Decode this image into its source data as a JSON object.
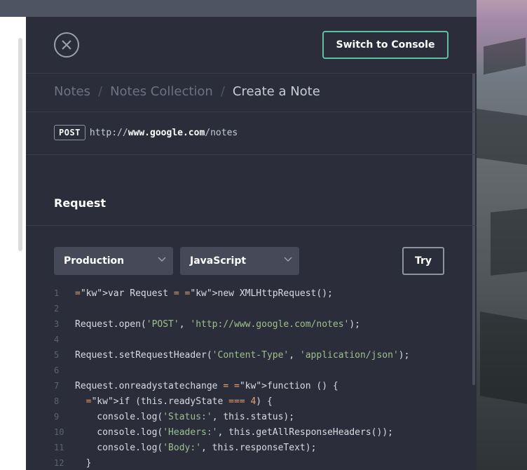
{
  "header": {
    "switch_label": "Switch to Console"
  },
  "breadcrumb": {
    "items": [
      "Notes",
      "Notes Collection"
    ],
    "current": "Create a Note"
  },
  "endpoint": {
    "method": "POST",
    "url_prefix": "http://",
    "url_host": "www.google.com",
    "url_path": "/notes"
  },
  "request": {
    "title": "Request",
    "environment": "Production",
    "language": "JavaScript",
    "try_label": "Try"
  },
  "code_lines": [
    "var Request = new XMLHttpRequest();",
    "",
    "Request.open('POST', 'http://www.google.com/notes');",
    "",
    "Request.setRequestHeader('Content-Type', 'application/json');",
    "",
    "Request.onreadystatechange = function () {",
    "  if (this.readyState === 4) {",
    "    console.log('Status:', this.status);",
    "    console.log('Headers:', this.getAllResponseHeaders());",
    "    console.log('Body:', this.responseText);",
    "  }"
  ],
  "colors": {
    "accent": "#5fbfa4",
    "panel_bg": "#2b2e3a",
    "select_bg": "#464a58"
  },
  "icons": {
    "close": "close-icon",
    "chevron": "chevron-down-icon"
  }
}
